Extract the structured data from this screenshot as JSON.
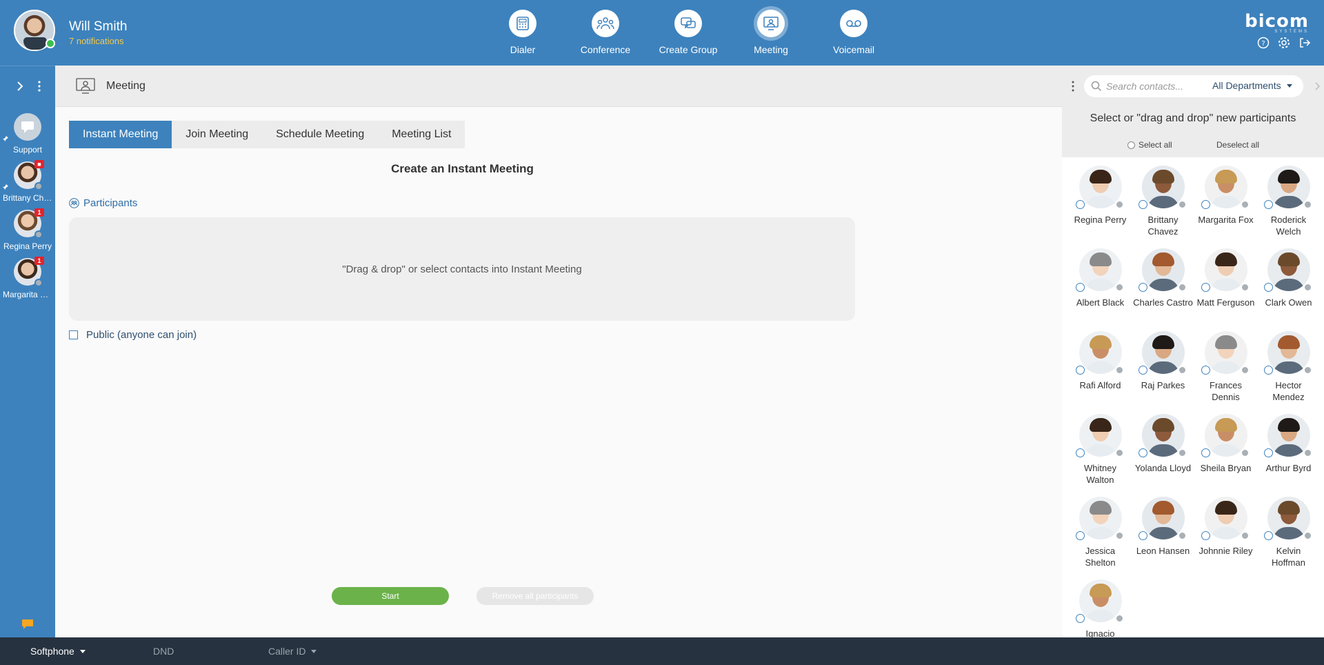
{
  "header": {
    "user_name": "Will Smith",
    "notifications": "7 notifications",
    "nav": [
      {
        "label": "Dialer",
        "icon": "dialer-icon"
      },
      {
        "label": "Conference",
        "icon": "conference-icon"
      },
      {
        "label": "Create Group",
        "icon": "create-group-icon"
      },
      {
        "label": "Meeting",
        "icon": "meeting-icon",
        "active": true
      },
      {
        "label": "Voicemail",
        "icon": "voicemail-icon"
      }
    ],
    "brand": "bicom",
    "brand_sub": "SYSTEMS"
  },
  "sidebar": {
    "contacts": [
      {
        "name": "Support",
        "badge": ""
      },
      {
        "name": "Brittany Chavez",
        "badge": "■"
      },
      {
        "name": "Regina Perry",
        "badge": "1"
      },
      {
        "name": "Margarita Fox",
        "badge": "1"
      }
    ]
  },
  "subheader": {
    "title": "Meeting"
  },
  "main": {
    "tabs": [
      {
        "label": "Instant Meeting",
        "active": true
      },
      {
        "label": "Join Meeting"
      },
      {
        "label": "Schedule Meeting"
      },
      {
        "label": "Meeting List"
      }
    ],
    "title": "Create an Instant Meeting",
    "participants_label": "Participants",
    "drop_text": "\"Drag & drop\" or select contacts into Instant Meeting",
    "public_label": "Public (anyone can join)",
    "start_label": "Start",
    "remove_label": "Remove all participants"
  },
  "right_panel": {
    "search_placeholder": "Search contacts...",
    "department": "All Departments",
    "instruction": "Select or \"drag and drop\" new participants",
    "select_all": "Select all",
    "deselect_all": "Deselect all",
    "contacts": [
      {
        "name": "Regina Perry"
      },
      {
        "name": "Brittany Chavez"
      },
      {
        "name": "Margarita Fox"
      },
      {
        "name": "Roderick Welch"
      },
      {
        "name": "Albert Black"
      },
      {
        "name": "Charles Castro"
      },
      {
        "name": "Matt Ferguson"
      },
      {
        "name": "Clark Owen"
      },
      {
        "name": "Rafi Alford"
      },
      {
        "name": "Raj Parkes"
      },
      {
        "name": "Frances Dennis"
      },
      {
        "name": "Hector Mendez"
      },
      {
        "name": "Whitney Walton"
      },
      {
        "name": "Yolanda Lloyd"
      },
      {
        "name": "Sheila Bryan"
      },
      {
        "name": "Arthur Byrd"
      },
      {
        "name": "Jessica Shelton"
      },
      {
        "name": "Leon Hansen"
      },
      {
        "name": "Johnnie Riley"
      },
      {
        "name": "Kelvin Hoffman"
      },
      {
        "name": "Ignacio"
      }
    ]
  },
  "bottom_bar": {
    "softphone": "Softphone",
    "dnd": "DND",
    "caller_id": "Caller ID"
  },
  "colors": {
    "primary": "#3d82bd",
    "start": "#6cb24a",
    "bottom_bar": "#26323f",
    "badge": "#e2242c",
    "online": "#3cc04f"
  }
}
